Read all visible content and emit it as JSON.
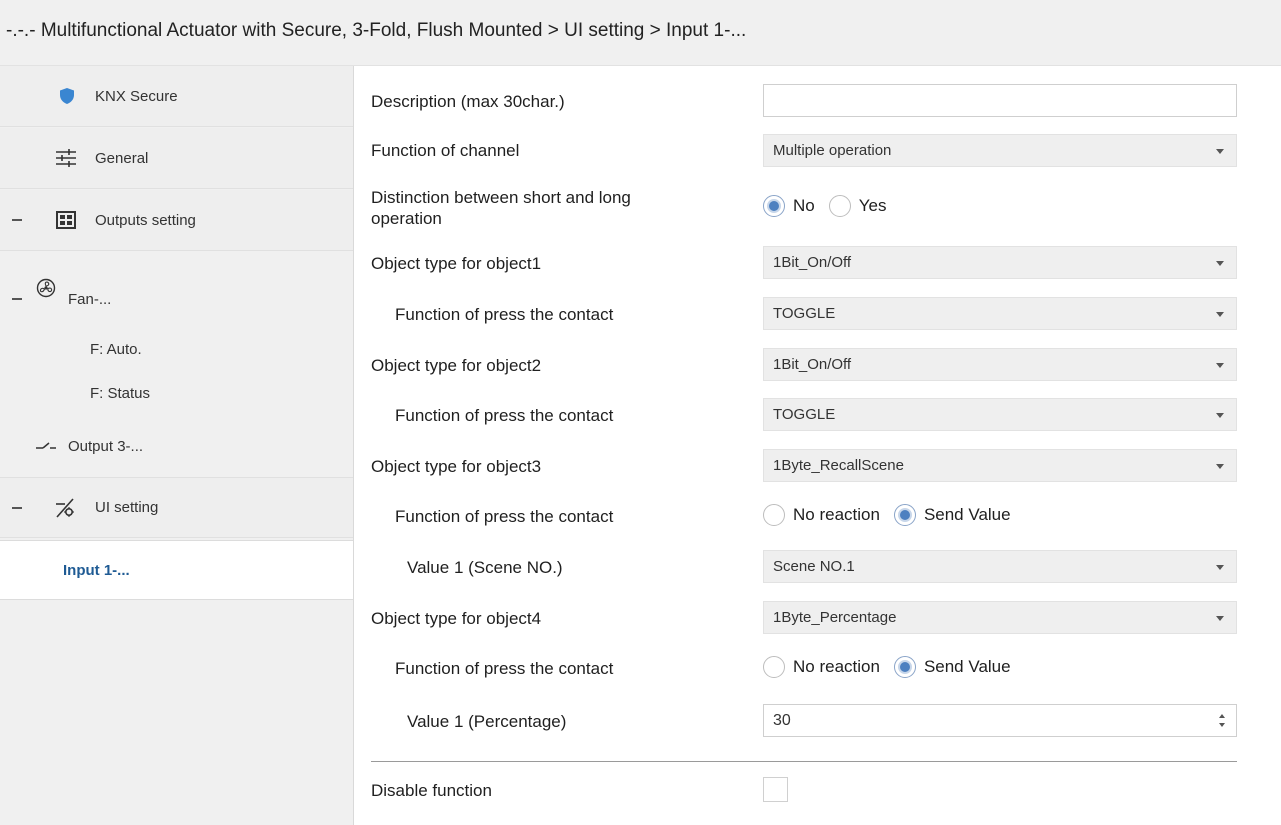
{
  "header": {
    "title": "-.-.- Multifunctional Actuator with Secure, 3-Fold, Flush Mounted > UI setting > Input 1-..."
  },
  "sidebar": {
    "items": [
      {
        "label": "KNX Secure",
        "icon": "shield-icon"
      },
      {
        "label": "General",
        "icon": "sliders-icon"
      },
      {
        "label": "Outputs setting",
        "icon": "grid-icon"
      },
      {
        "label": "Fan-...",
        "icon": "fan-icon"
      },
      {
        "label": "F: Auto."
      },
      {
        "label": "F: Status"
      },
      {
        "label": "Output 3-...",
        "icon": "switch-icon"
      },
      {
        "label": "UI setting",
        "icon": "ui-setting-icon"
      },
      {
        "label": "Input 1-..."
      }
    ]
  },
  "params": {
    "description": {
      "label": "Description (max 30char.)",
      "value": ""
    },
    "function_channel": {
      "label": "Function of channel",
      "value": "Multiple operation"
    },
    "distinction": {
      "label_line1": "Distinction between short and long",
      "label_line2": "operation",
      "opt1": "No",
      "opt2": "Yes",
      "selected": "No"
    },
    "obj1_type": {
      "label": "Object type for object1",
      "value": "1Bit_On/Off"
    },
    "obj1_func": {
      "label": "Function of press the contact",
      "value": "TOGGLE"
    },
    "obj2_type": {
      "label": "Object type for object2",
      "value": "1Bit_On/Off"
    },
    "obj2_func": {
      "label": "Function of press the contact",
      "value": "TOGGLE"
    },
    "obj3_type": {
      "label": "Object type for object3",
      "value": "1Byte_RecallScene"
    },
    "obj3_func": {
      "label": "Function of press the contact",
      "opt1": "No reaction",
      "opt2": "Send Value",
      "selected": "Send Value"
    },
    "obj3_value": {
      "label": "Value 1 (Scene NO.)",
      "value": "Scene NO.1"
    },
    "obj4_type": {
      "label": "Object type for object4",
      "value": "1Byte_Percentage"
    },
    "obj4_func": {
      "label": "Function of press the contact",
      "opt1": "No reaction",
      "opt2": "Send Value",
      "selected": "Send Value"
    },
    "obj4_value": {
      "label": "Value 1 (Percentage)",
      "value": "30"
    },
    "disable": {
      "label": "Disable function",
      "checked": false
    }
  },
  "colors": {
    "accent": "#1f5b94",
    "shield": "#3a86d1",
    "radio_selected": "#4d80c0"
  }
}
